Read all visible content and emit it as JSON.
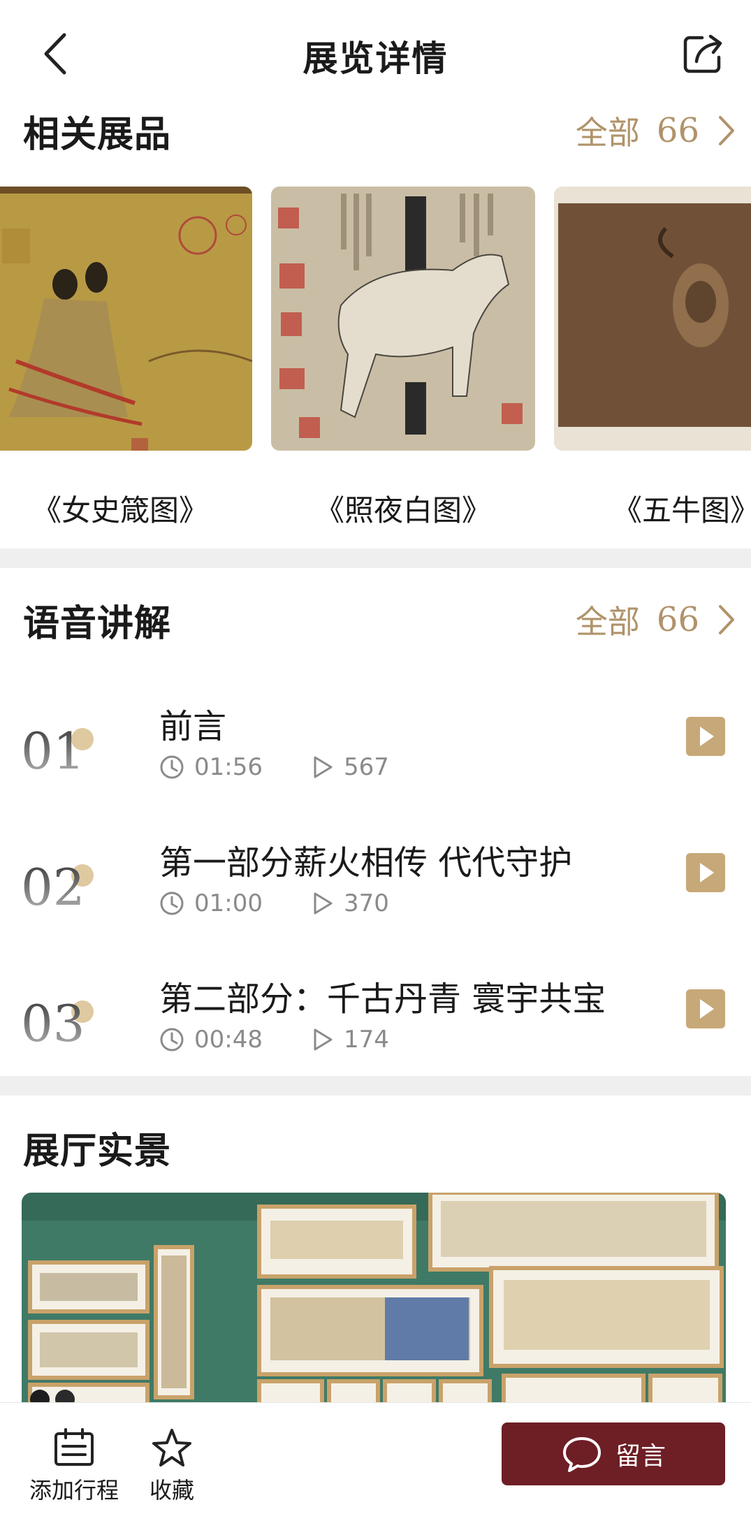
{
  "header": {
    "title": "展览详情"
  },
  "related": {
    "title": "相关展品",
    "see_all_label": "全部",
    "count": "66",
    "items": [
      {
        "name": "《女史箴图》"
      },
      {
        "name": "《照夜白图》"
      },
      {
        "name": "《五牛图》"
      }
    ]
  },
  "audio": {
    "title": "语音讲解",
    "see_all_label": "全部",
    "count": "66",
    "tracks": [
      {
        "num": "01",
        "title": "前言",
        "duration": "01:56",
        "plays": "567"
      },
      {
        "num": "02",
        "title": "第一部分薪火相传  代代守护",
        "duration": "01:00",
        "plays": "370"
      },
      {
        "num": "03",
        "title": "第二部分：千古丹青  寰宇共宝",
        "duration": "00:48",
        "plays": "174"
      }
    ]
  },
  "hall": {
    "title": "展厅实景"
  },
  "bottom": {
    "add_schedule": "添加行程",
    "favorite": "收藏",
    "comment": "留言"
  },
  "colors": {
    "accent": "#b0936a",
    "play": "#c7a878",
    "primary_button": "#6e1e25"
  }
}
